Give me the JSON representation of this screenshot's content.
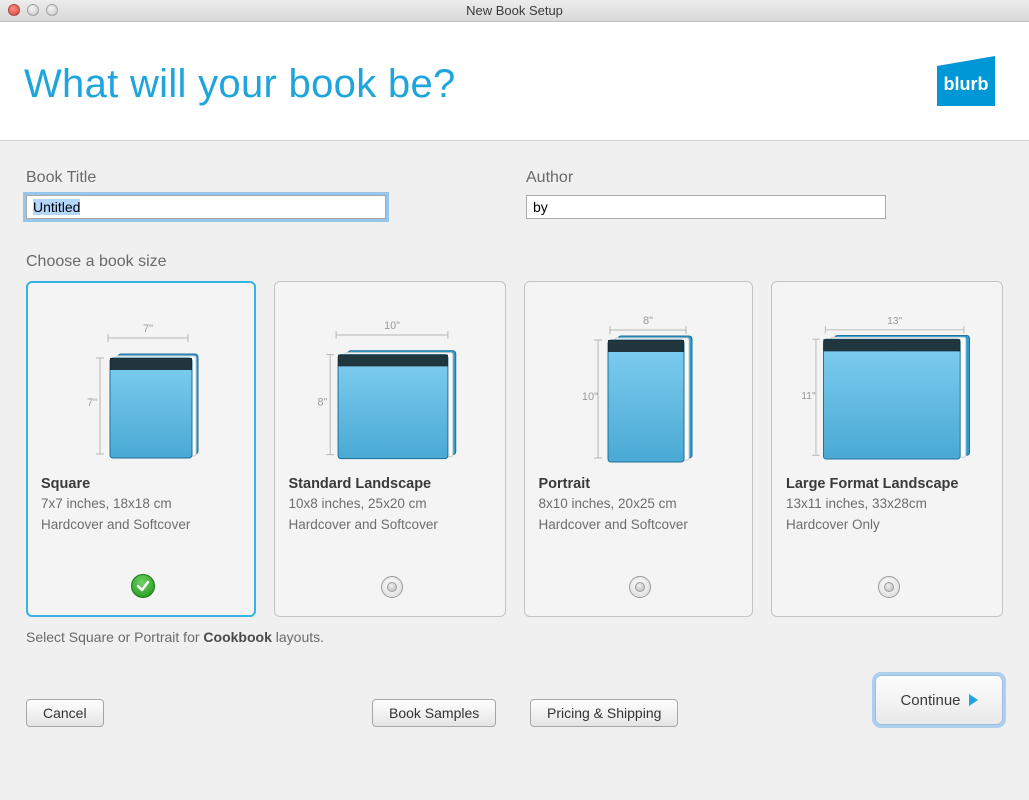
{
  "window": {
    "title": "New Book Setup"
  },
  "header": {
    "headline": "What will your book be?",
    "brand": "blurb"
  },
  "fields": {
    "book_title": {
      "label": "Book Title",
      "value": "Untitled"
    },
    "author": {
      "label": "Author",
      "value": "by"
    }
  },
  "choose_label": "Choose a book size",
  "sizes": [
    {
      "name": "Square",
      "dims": "7x7 inches, 18x18 cm",
      "cover": "Hardcover and Softcover",
      "w_label": "7\"",
      "h_label": "7\"",
      "selected": true
    },
    {
      "name": "Standard Landscape",
      "dims": "10x8 inches, 25x20 cm",
      "cover": "Hardcover and Softcover",
      "w_label": "10\"",
      "h_label": "8\"",
      "selected": false
    },
    {
      "name": "Portrait",
      "dims": "8x10 inches, 20x25 cm",
      "cover": "Hardcover and Softcover",
      "w_label": "8\"",
      "h_label": "10\"",
      "selected": false
    },
    {
      "name": "Large Format Landscape",
      "dims": "13x11 inches, 33x28cm",
      "cover": "Hardcover Only",
      "w_label": "13\"",
      "h_label": "11\"",
      "selected": false
    }
  ],
  "hint": {
    "pre": "Select Square or Portrait for ",
    "bold": "Cookbook",
    "post": " layouts."
  },
  "buttons": {
    "cancel": "Cancel",
    "samples": "Book Samples",
    "pricing": "Pricing & Shipping",
    "continue": "Continue"
  }
}
